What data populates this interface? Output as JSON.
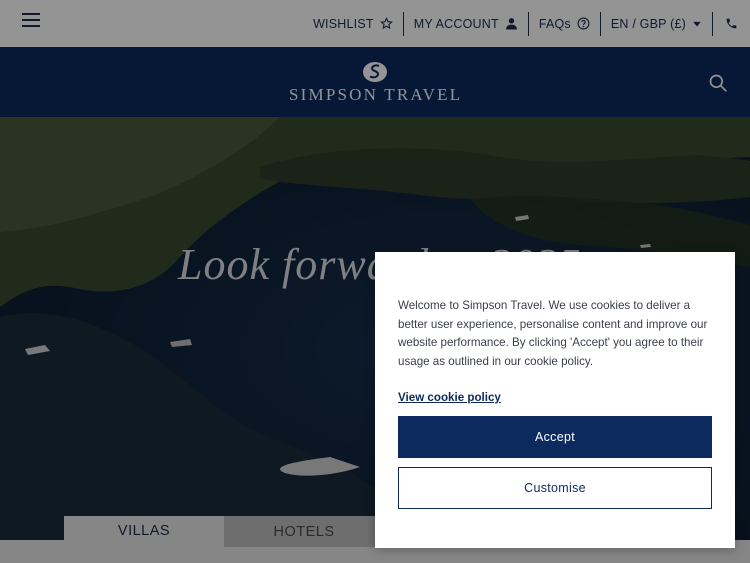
{
  "topbar": {
    "wishlist": "WISHLIST",
    "account": "MY ACCOUNT",
    "faqs": "FAQs",
    "currency": "EN / GBP (£)"
  },
  "header": {
    "brand": "SIMPSON TRAVEL"
  },
  "hero": {
    "headline": "Look forward to 2025"
  },
  "tabs": [
    {
      "label": "VILLAS"
    },
    {
      "label": "HOTELS"
    }
  ],
  "cookie": {
    "message": "Welcome to Simpson Travel. We use cookies to deliver a better user experience, personalise content and improve our website performance. By clicking 'Accept' you agree to their usage as outlined in our cookie policy.",
    "policy_link": "View cookie policy",
    "accept_label": "Accept",
    "customise_label": "Customise"
  },
  "colors": {
    "brand_navy": "#0d2a5e",
    "overlay": "rgba(0,0,0,0.42)"
  }
}
